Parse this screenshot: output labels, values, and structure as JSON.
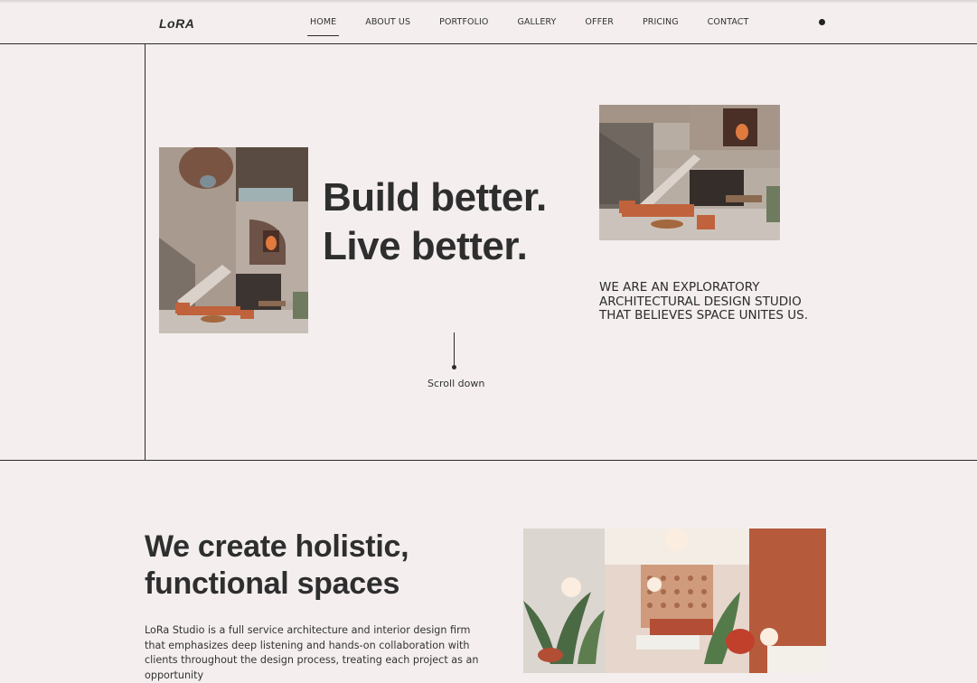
{
  "brand": {
    "logo": "LoRA"
  },
  "nav": {
    "items": [
      {
        "label": "HOME",
        "active": true
      },
      {
        "label": "ABOUT US"
      },
      {
        "label": "PORTFOLIO"
      },
      {
        "label": "GALLERY"
      },
      {
        "label": "OFFER"
      },
      {
        "label": "PRICING"
      },
      {
        "label": "CONTACT"
      }
    ]
  },
  "hero": {
    "headline_1": "Build better.",
    "headline_2": "Live better.",
    "tagline": "WE ARE AN EXPLORATORY ARCHITECTURAL DESIGN STUDIO THAT BELIEVES SPACE UNITES US.",
    "scroll_label": "Scroll down"
  },
  "about": {
    "title_1": "We create holistic,",
    "title_2": "functional spaces",
    "body": "LoRa Studio is a full service architecture and interior design firm that emphasizes deep listening and hands-on collaboration with clients throughout the design process, treating each project as an opportunity"
  },
  "colors": {
    "background": "#f4eeee",
    "text": "#2b2b2b",
    "accent_terracotta": "#c0623b",
    "concrete": "#b7aba1"
  }
}
